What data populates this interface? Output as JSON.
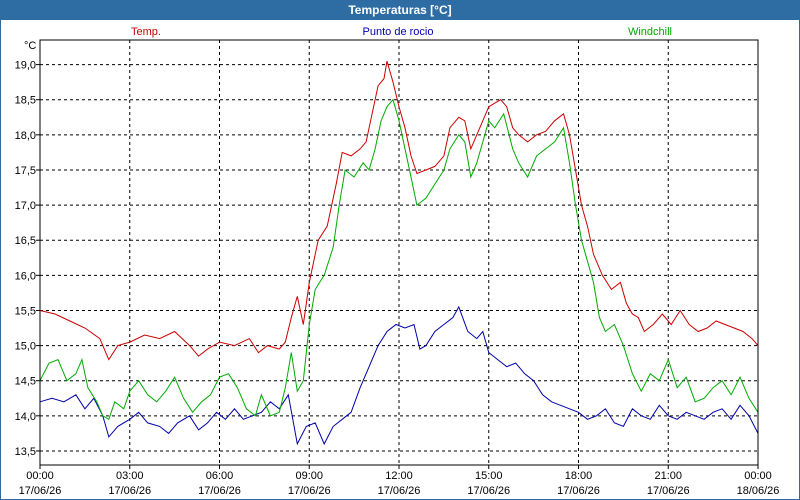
{
  "window": {
    "title": "Temperaturas [°C]"
  },
  "chart_data": {
    "type": "line",
    "title": "Temperaturas [°C]",
    "ylabel": "°C",
    "ylim": [
      13.3,
      19.35
    ],
    "yticks": [
      "13,5",
      "14,0",
      "14,5",
      "15,0",
      "15,5",
      "16,0",
      "16,5",
      "17,0",
      "17,5",
      "18,0",
      "18,5",
      "19,0"
    ],
    "ytick_values": [
      13.5,
      14.0,
      14.5,
      15.0,
      15.5,
      16.0,
      16.5,
      17.0,
      17.5,
      18.0,
      18.5,
      19.0
    ],
    "x_hours_range": [
      0,
      24
    ],
    "xticks": [
      {
        "time": "00:00",
        "date": "17/06/26",
        "hour": 0
      },
      {
        "time": "03:00",
        "date": "17/06/26",
        "hour": 3
      },
      {
        "time": "06:00",
        "date": "17/06/26",
        "hour": 6
      },
      {
        "time": "09:00",
        "date": "17/06/26",
        "hour": 9
      },
      {
        "time": "12:00",
        "date": "17/06/26",
        "hour": 12
      },
      {
        "time": "15:00",
        "date": "17/06/26",
        "hour": 15
      },
      {
        "time": "18:00",
        "date": "17/06/26",
        "hour": 18
      },
      {
        "time": "21:00",
        "date": "17/06/26",
        "hour": 21
      },
      {
        "time": "00:00",
        "date": "18/06/26",
        "hour": 24
      }
    ],
    "grid": true,
    "legend_position": "top",
    "series": [
      {
        "name": "Temp.",
        "color": "#cc0000",
        "points": [
          [
            0,
            15.5
          ],
          [
            0.5,
            15.45
          ],
          [
            1,
            15.35
          ],
          [
            1.5,
            15.25
          ],
          [
            2,
            15.1
          ],
          [
            2.3,
            14.8
          ],
          [
            2.6,
            15.0
          ],
          [
            3,
            15.05
          ],
          [
            3.5,
            15.15
          ],
          [
            4,
            15.1
          ],
          [
            4.5,
            15.2
          ],
          [
            5,
            15.0
          ],
          [
            5.3,
            14.85
          ],
          [
            5.6,
            14.95
          ],
          [
            6,
            15.05
          ],
          [
            6.5,
            15.0
          ],
          [
            7,
            15.1
          ],
          [
            7.3,
            14.9
          ],
          [
            7.6,
            15.0
          ],
          [
            8,
            14.95
          ],
          [
            8.2,
            15.05
          ],
          [
            8.4,
            15.4
          ],
          [
            8.6,
            15.7
          ],
          [
            8.8,
            15.3
          ],
          [
            9,
            15.9
          ],
          [
            9.3,
            16.5
          ],
          [
            9.6,
            16.7
          ],
          [
            9.9,
            17.3
          ],
          [
            10.1,
            17.75
          ],
          [
            10.4,
            17.7
          ],
          [
            10.7,
            17.8
          ],
          [
            10.9,
            17.9
          ],
          [
            11.1,
            18.3
          ],
          [
            11.3,
            18.7
          ],
          [
            11.5,
            18.8
          ],
          [
            11.6,
            19.05
          ],
          [
            11.8,
            18.75
          ],
          [
            12.0,
            18.4
          ],
          [
            12.2,
            18.1
          ],
          [
            12.4,
            17.7
          ],
          [
            12.6,
            17.45
          ],
          [
            12.9,
            17.5
          ],
          [
            13.2,
            17.55
          ],
          [
            13.5,
            17.7
          ],
          [
            13.7,
            18.1
          ],
          [
            14.0,
            18.25
          ],
          [
            14.2,
            18.2
          ],
          [
            14.4,
            17.8
          ],
          [
            14.6,
            18.0
          ],
          [
            14.8,
            18.2
          ],
          [
            15.0,
            18.4
          ],
          [
            15.2,
            18.45
          ],
          [
            15.4,
            18.5
          ],
          [
            15.6,
            18.4
          ],
          [
            15.8,
            18.1
          ],
          [
            16.0,
            18.0
          ],
          [
            16.3,
            17.9
          ],
          [
            16.6,
            18.0
          ],
          [
            16.9,
            18.05
          ],
          [
            17.2,
            18.2
          ],
          [
            17.5,
            18.3
          ],
          [
            17.7,
            18.0
          ],
          [
            17.9,
            17.5
          ],
          [
            18.1,
            17.0
          ],
          [
            18.3,
            16.7
          ],
          [
            18.5,
            16.3
          ],
          [
            18.8,
            16.0
          ],
          [
            19.1,
            15.8
          ],
          [
            19.4,
            15.9
          ],
          [
            19.6,
            15.6
          ],
          [
            19.8,
            15.45
          ],
          [
            20.0,
            15.4
          ],
          [
            20.2,
            15.2
          ],
          [
            20.5,
            15.3
          ],
          [
            20.8,
            15.45
          ],
          [
            21.1,
            15.3
          ],
          [
            21.4,
            15.5
          ],
          [
            21.7,
            15.3
          ],
          [
            22.0,
            15.2
          ],
          [
            22.3,
            15.25
          ],
          [
            22.6,
            15.35
          ],
          [
            22.9,
            15.3
          ],
          [
            23.2,
            15.25
          ],
          [
            23.5,
            15.2
          ],
          [
            23.8,
            15.1
          ],
          [
            24,
            15.0
          ]
        ]
      },
      {
        "name": "Punto de rocio",
        "color": "#0000aa",
        "points": [
          [
            0,
            14.2
          ],
          [
            0.4,
            14.25
          ],
          [
            0.8,
            14.2
          ],
          [
            1.2,
            14.3
          ],
          [
            1.5,
            14.1
          ],
          [
            1.8,
            14.25
          ],
          [
            2.1,
            14.0
          ],
          [
            2.3,
            13.7
          ],
          [
            2.6,
            13.85
          ],
          [
            3.0,
            13.95
          ],
          [
            3.3,
            14.05
          ],
          [
            3.6,
            13.9
          ],
          [
            4.0,
            13.85
          ],
          [
            4.3,
            13.75
          ],
          [
            4.6,
            13.9
          ],
          [
            5.0,
            14.0
          ],
          [
            5.3,
            13.8
          ],
          [
            5.6,
            13.9
          ],
          [
            5.9,
            14.05
          ],
          [
            6.2,
            13.95
          ],
          [
            6.5,
            14.1
          ],
          [
            6.8,
            13.95
          ],
          [
            7.1,
            14.0
          ],
          [
            7.4,
            14.05
          ],
          [
            7.7,
            14.2
          ],
          [
            8.0,
            14.1
          ],
          [
            8.3,
            14.3
          ],
          [
            8.6,
            13.6
          ],
          [
            8.9,
            13.85
          ],
          [
            9.2,
            13.9
          ],
          [
            9.5,
            13.6
          ],
          [
            9.8,
            13.85
          ],
          [
            10.1,
            13.95
          ],
          [
            10.4,
            14.05
          ],
          [
            10.7,
            14.4
          ],
          [
            11.0,
            14.7
          ],
          [
            11.3,
            15.0
          ],
          [
            11.6,
            15.2
          ],
          [
            11.9,
            15.3
          ],
          [
            12.2,
            15.25
          ],
          [
            12.5,
            15.3
          ],
          [
            12.7,
            14.95
          ],
          [
            12.9,
            15.0
          ],
          [
            13.2,
            15.2
          ],
          [
            13.5,
            15.3
          ],
          [
            13.8,
            15.4
          ],
          [
            14.0,
            15.55
          ],
          [
            14.3,
            15.2
          ],
          [
            14.6,
            15.1
          ],
          [
            14.8,
            15.2
          ],
          [
            15.0,
            14.9
          ],
          [
            15.3,
            14.8
          ],
          [
            15.6,
            14.7
          ],
          [
            15.9,
            14.75
          ],
          [
            16.2,
            14.6
          ],
          [
            16.5,
            14.5
          ],
          [
            16.8,
            14.3
          ],
          [
            17.1,
            14.2
          ],
          [
            17.4,
            14.15
          ],
          [
            17.7,
            14.1
          ],
          [
            18.0,
            14.05
          ],
          [
            18.3,
            13.95
          ],
          [
            18.6,
            14.0
          ],
          [
            18.9,
            14.1
          ],
          [
            19.2,
            13.9
          ],
          [
            19.5,
            13.85
          ],
          [
            19.8,
            14.1
          ],
          [
            20.1,
            14.0
          ],
          [
            20.4,
            13.95
          ],
          [
            20.7,
            14.15
          ],
          [
            21.0,
            14.0
          ],
          [
            21.3,
            13.95
          ],
          [
            21.6,
            14.05
          ],
          [
            21.9,
            14.0
          ],
          [
            22.2,
            13.95
          ],
          [
            22.5,
            14.05
          ],
          [
            22.8,
            14.1
          ],
          [
            23.1,
            13.95
          ],
          [
            23.4,
            14.15
          ],
          [
            23.7,
            14.0
          ],
          [
            24,
            13.75
          ]
        ]
      },
      {
        "name": "Windchill",
        "color": "#00aa00",
        "points": [
          [
            0,
            14.5
          ],
          [
            0.3,
            14.75
          ],
          [
            0.6,
            14.8
          ],
          [
            0.9,
            14.5
          ],
          [
            1.2,
            14.6
          ],
          [
            1.4,
            14.8
          ],
          [
            1.6,
            14.4
          ],
          [
            1.9,
            14.2
          ],
          [
            2.1,
            14.0
          ],
          [
            2.3,
            13.95
          ],
          [
            2.5,
            14.2
          ],
          [
            2.8,
            14.1
          ],
          [
            3.0,
            14.35
          ],
          [
            3.3,
            14.5
          ],
          [
            3.6,
            14.3
          ],
          [
            3.9,
            14.2
          ],
          [
            4.2,
            14.35
          ],
          [
            4.5,
            14.55
          ],
          [
            4.8,
            14.25
          ],
          [
            5.1,
            14.05
          ],
          [
            5.4,
            14.2
          ],
          [
            5.7,
            14.3
          ],
          [
            6.0,
            14.55
          ],
          [
            6.3,
            14.6
          ],
          [
            6.6,
            14.4
          ],
          [
            6.9,
            14.1
          ],
          [
            7.2,
            14.0
          ],
          [
            7.4,
            14.3
          ],
          [
            7.7,
            14.0
          ],
          [
            8.0,
            14.05
          ],
          [
            8.2,
            14.4
          ],
          [
            8.4,
            14.9
          ],
          [
            8.6,
            14.35
          ],
          [
            8.8,
            14.5
          ],
          [
            9.0,
            15.3
          ],
          [
            9.2,
            15.8
          ],
          [
            9.5,
            16.0
          ],
          [
            9.8,
            16.4
          ],
          [
            10.0,
            17.0
          ],
          [
            10.2,
            17.5
          ],
          [
            10.5,
            17.4
          ],
          [
            10.8,
            17.6
          ],
          [
            11.0,
            17.5
          ],
          [
            11.2,
            17.8
          ],
          [
            11.4,
            18.2
          ],
          [
            11.6,
            18.4
          ],
          [
            11.8,
            18.5
          ],
          [
            12.0,
            18.2
          ],
          [
            12.2,
            17.8
          ],
          [
            12.4,
            17.4
          ],
          [
            12.6,
            17.0
          ],
          [
            12.9,
            17.1
          ],
          [
            13.2,
            17.3
          ],
          [
            13.5,
            17.5
          ],
          [
            13.7,
            17.8
          ],
          [
            14.0,
            18.0
          ],
          [
            14.2,
            17.9
          ],
          [
            14.4,
            17.4
          ],
          [
            14.6,
            17.6
          ],
          [
            14.8,
            17.9
          ],
          [
            15.0,
            18.2
          ],
          [
            15.2,
            18.1
          ],
          [
            15.5,
            18.3
          ],
          [
            15.8,
            17.8
          ],
          [
            16.0,
            17.6
          ],
          [
            16.3,
            17.4
          ],
          [
            16.6,
            17.7
          ],
          [
            16.9,
            17.8
          ],
          [
            17.2,
            17.9
          ],
          [
            17.5,
            18.1
          ],
          [
            17.7,
            17.6
          ],
          [
            17.9,
            17.0
          ],
          [
            18.1,
            16.5
          ],
          [
            18.3,
            16.2
          ],
          [
            18.5,
            15.9
          ],
          [
            18.7,
            15.4
          ],
          [
            18.9,
            15.2
          ],
          [
            19.2,
            15.3
          ],
          [
            19.5,
            15.0
          ],
          [
            19.8,
            14.6
          ],
          [
            20.1,
            14.35
          ],
          [
            20.4,
            14.6
          ],
          [
            20.7,
            14.5
          ],
          [
            21.0,
            14.8
          ],
          [
            21.3,
            14.4
          ],
          [
            21.6,
            14.55
          ],
          [
            21.9,
            14.2
          ],
          [
            22.2,
            14.25
          ],
          [
            22.5,
            14.4
          ],
          [
            22.8,
            14.5
          ],
          [
            23.1,
            14.3
          ],
          [
            23.4,
            14.55
          ],
          [
            23.7,
            14.25
          ],
          [
            24,
            14.05
          ]
        ]
      }
    ]
  }
}
